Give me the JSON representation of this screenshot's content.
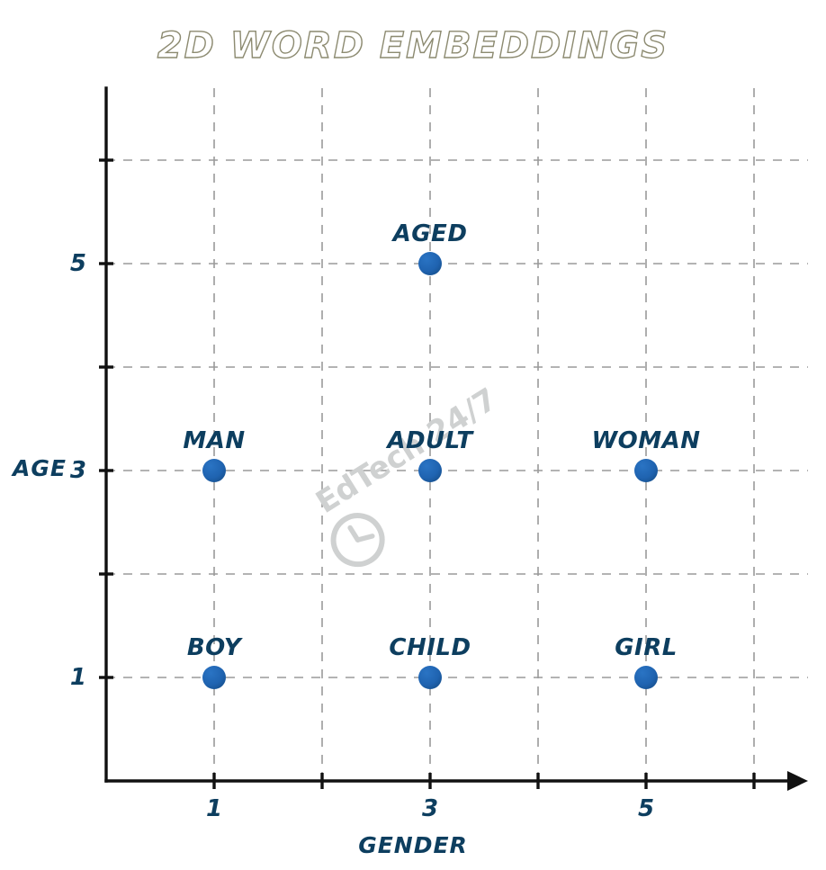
{
  "chart_data": {
    "type": "scatter",
    "title": "2D WORD EMBEDDINGS",
    "xlabel": "GENDER",
    "ylabel": "AGE",
    "xlim": [
      0,
      7
    ],
    "ylim": [
      0,
      7
    ],
    "grid": true,
    "legend_position": "none",
    "x_ticks": [
      1,
      2,
      3,
      4,
      5,
      6
    ],
    "x_tick_labels": [
      "1",
      "",
      "3",
      "",
      "5",
      ""
    ],
    "y_ticks": [
      1,
      2,
      3,
      4,
      5,
      6
    ],
    "y_tick_labels": [
      "1",
      "",
      "3",
      "",
      "5",
      ""
    ],
    "point_color": "#1f63b0",
    "label_color": "#0d3e5f",
    "points": [
      {
        "label": "BOY",
        "x": 1,
        "y": 1
      },
      {
        "label": "CHILD",
        "x": 3,
        "y": 1
      },
      {
        "label": "GIRL",
        "x": 5,
        "y": 1
      },
      {
        "label": "MAN",
        "x": 1,
        "y": 3
      },
      {
        "label": "ADULT",
        "x": 3,
        "y": 3
      },
      {
        "label": "WOMAN",
        "x": 5,
        "y": 3
      },
      {
        "label": "AGED",
        "x": 3,
        "y": 5
      }
    ]
  },
  "watermark": {
    "text": "EdTech 24/7",
    "icon": "clock-icon",
    "color": "#cfd1d1"
  },
  "colors": {
    "point": "#1f63b0",
    "label": "#0d3e5f",
    "axis": "#111111",
    "grid": "#9a9a9a",
    "title_outline": "#8c8a70",
    "background": "#ffffff"
  }
}
